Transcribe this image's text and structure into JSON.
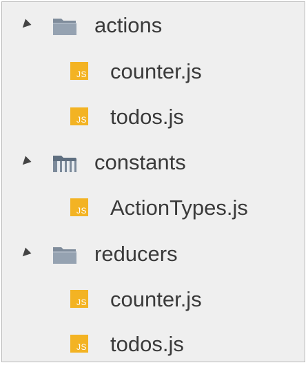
{
  "tree": {
    "items": [
      {
        "label": "actions",
        "kind": "folder",
        "expanded": true,
        "icon": "folder-icon"
      },
      {
        "label": "counter.js",
        "kind": "file",
        "icon": "js-file-icon",
        "badge": "JS"
      },
      {
        "label": "todos.js",
        "kind": "file",
        "icon": "js-file-icon",
        "badge": "JS"
      },
      {
        "label": "constants",
        "kind": "folder",
        "expanded": true,
        "icon": "folder-open-icon"
      },
      {
        "label": "ActionTypes.js",
        "kind": "file",
        "icon": "js-file-icon",
        "badge": "JS"
      },
      {
        "label": "reducers",
        "kind": "folder",
        "expanded": true,
        "icon": "folder-icon"
      },
      {
        "label": "counter.js",
        "kind": "file",
        "icon": "js-file-icon",
        "badge": "JS"
      },
      {
        "label": "todos.js",
        "kind": "file",
        "icon": "js-file-icon",
        "badge": "JS"
      }
    ]
  },
  "colors": {
    "js_badge": "#f3b323",
    "folder": "#8a97a6",
    "background": "#efefef",
    "text": "#3a3a3a"
  }
}
